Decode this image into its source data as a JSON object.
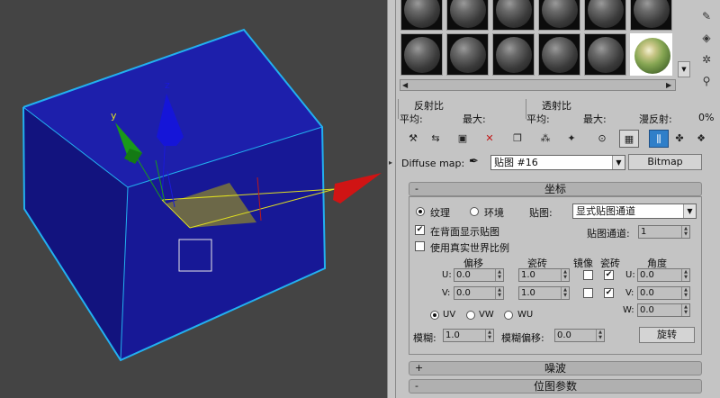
{
  "viewport": {
    "gizmo_axis_y": "y",
    "gizmo_axis_z": "z"
  },
  "panel": {
    "sample_slots": {
      "rows": 2,
      "cols": 6,
      "active_index": 11
    },
    "sidetools": [
      "eraser-icon",
      "sample-uv-icon",
      "make-unique-icon",
      "magnify-icon"
    ],
    "labels": {
      "reflect_ratio": "反射比",
      "transmit_ratio": "透射比",
      "avg_1": "平均:",
      "max_1": "最大:",
      "avg_2": "平均:",
      "max_2": "最大:",
      "diffuse_reflect": "漫反射:",
      "diffuse_reflect_value": "0%"
    },
    "toolbar_icons": [
      "get-material-icon",
      "put-to-scene-icon",
      "assign-material-icon",
      "delete-icon",
      "copy-material-icon",
      "make-unique-icon",
      "put-to-library-icon",
      "material-id-icon",
      "show-in-viewport-icon",
      "show-end-result-icon",
      "go-to-parent-icon",
      "go-forward-icon"
    ],
    "map_row": {
      "label": "Diffuse map:",
      "map_name": "贴图 #16",
      "map_type": "Bitmap"
    },
    "coords": {
      "title": "坐标",
      "pm": "-",
      "texture": "纹理",
      "environ": "环境",
      "mapping_label": "贴图:",
      "mapping_value": "显式贴图通道",
      "show_on_back": "在背面显示贴图",
      "use_real_world": "使用真实世界比例",
      "map_channel_label": "贴图通道:",
      "map_channel_value": "1",
      "offset": "偏移",
      "tiling": "瓷砖",
      "mirror": "镜像",
      "tile": "瓷砖",
      "angle": "角度",
      "u": "U:",
      "v": "V:",
      "w": "W:",
      "u_offset": "0.0",
      "u_tiling": "1.0",
      "v_offset": "0.0",
      "v_tiling": "1.0",
      "u_angle": "0.0",
      "v_angle": "0.0",
      "w_angle": "0.0",
      "uv": "UV",
      "vw": "VW",
      "wu": "WU",
      "blur_label": "模糊:",
      "blur_value": "1.0",
      "blur_offset_label": "模糊偏移:",
      "blur_offset_value": "0.0",
      "rotate": "旋转"
    },
    "noise": {
      "title": "噪波",
      "pm": "+"
    },
    "bitmap_params": {
      "title": "位图参数",
      "pm": "-"
    }
  },
  "colors": {
    "box_front": "#171896",
    "box_top": "#1d1fab",
    "box_side": "#12137e",
    "box_edge": "#22b0f0",
    "gizmo_y": "#1a9a1a",
    "gizmo_z": "#1515d8",
    "gizmo_x": "#d01414",
    "selected_face": "#6c6848"
  }
}
